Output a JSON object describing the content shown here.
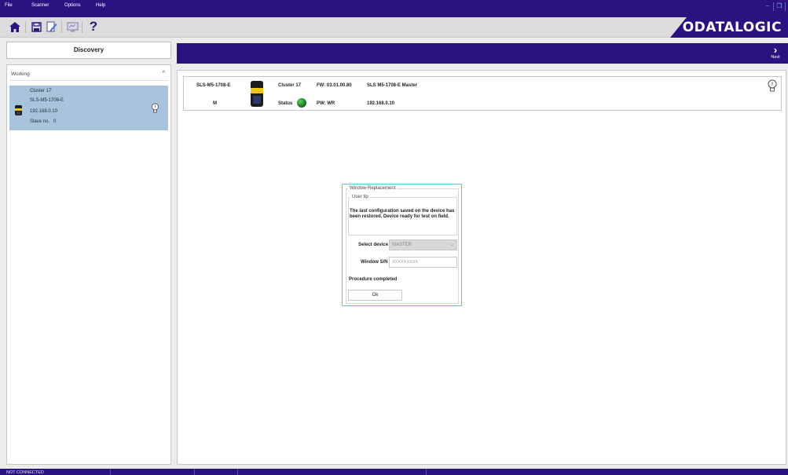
{
  "menu": {
    "items": [
      "File",
      "Scanner",
      "Options",
      "Help"
    ]
  },
  "window_controls": {
    "minimize": "–",
    "restore": "❐"
  },
  "toolbar": {
    "icons": [
      "home-icon",
      "save-icon",
      "edit-doc-icon",
      "monitor-icon",
      "help-icon"
    ],
    "help_glyph": "?"
  },
  "brand": {
    "logo": "ODATALOGIC",
    "color": "#2a1380"
  },
  "left": {
    "discovery_label": "Discovery",
    "group_label": "Working",
    "device": {
      "cluster": "Cluster 17",
      "model": "SLS-M5-1708-E",
      "ip": "192.168.0.10",
      "slave": "Slave no.   0"
    }
  },
  "header": {
    "next_label": "Next"
  },
  "device_row": {
    "model": "SLS-M5-1708-E",
    "role_short": "M",
    "cluster": "Cluster 17",
    "status_label": "Status",
    "fw": "FW: 03.01.00.80",
    "pw": "PW: WR",
    "name": "SLS M5-1708-E Master",
    "ip": "192.168.0.10",
    "status_color": "#1a8a1a"
  },
  "dialog": {
    "title": "Window Replacement",
    "tip_legend": "User tip",
    "tip_text": "The last configuration saved on the device has been restored. Device ready for test on field.",
    "select_label": "Select device",
    "select_value": "MASTER",
    "sn_label": "Window S/N",
    "sn_placeholder": "XXXXXXXXX",
    "procedure": "Procedure completed",
    "ok_label": "Ok"
  },
  "status": {
    "connection": "NOT CONNECTED"
  }
}
